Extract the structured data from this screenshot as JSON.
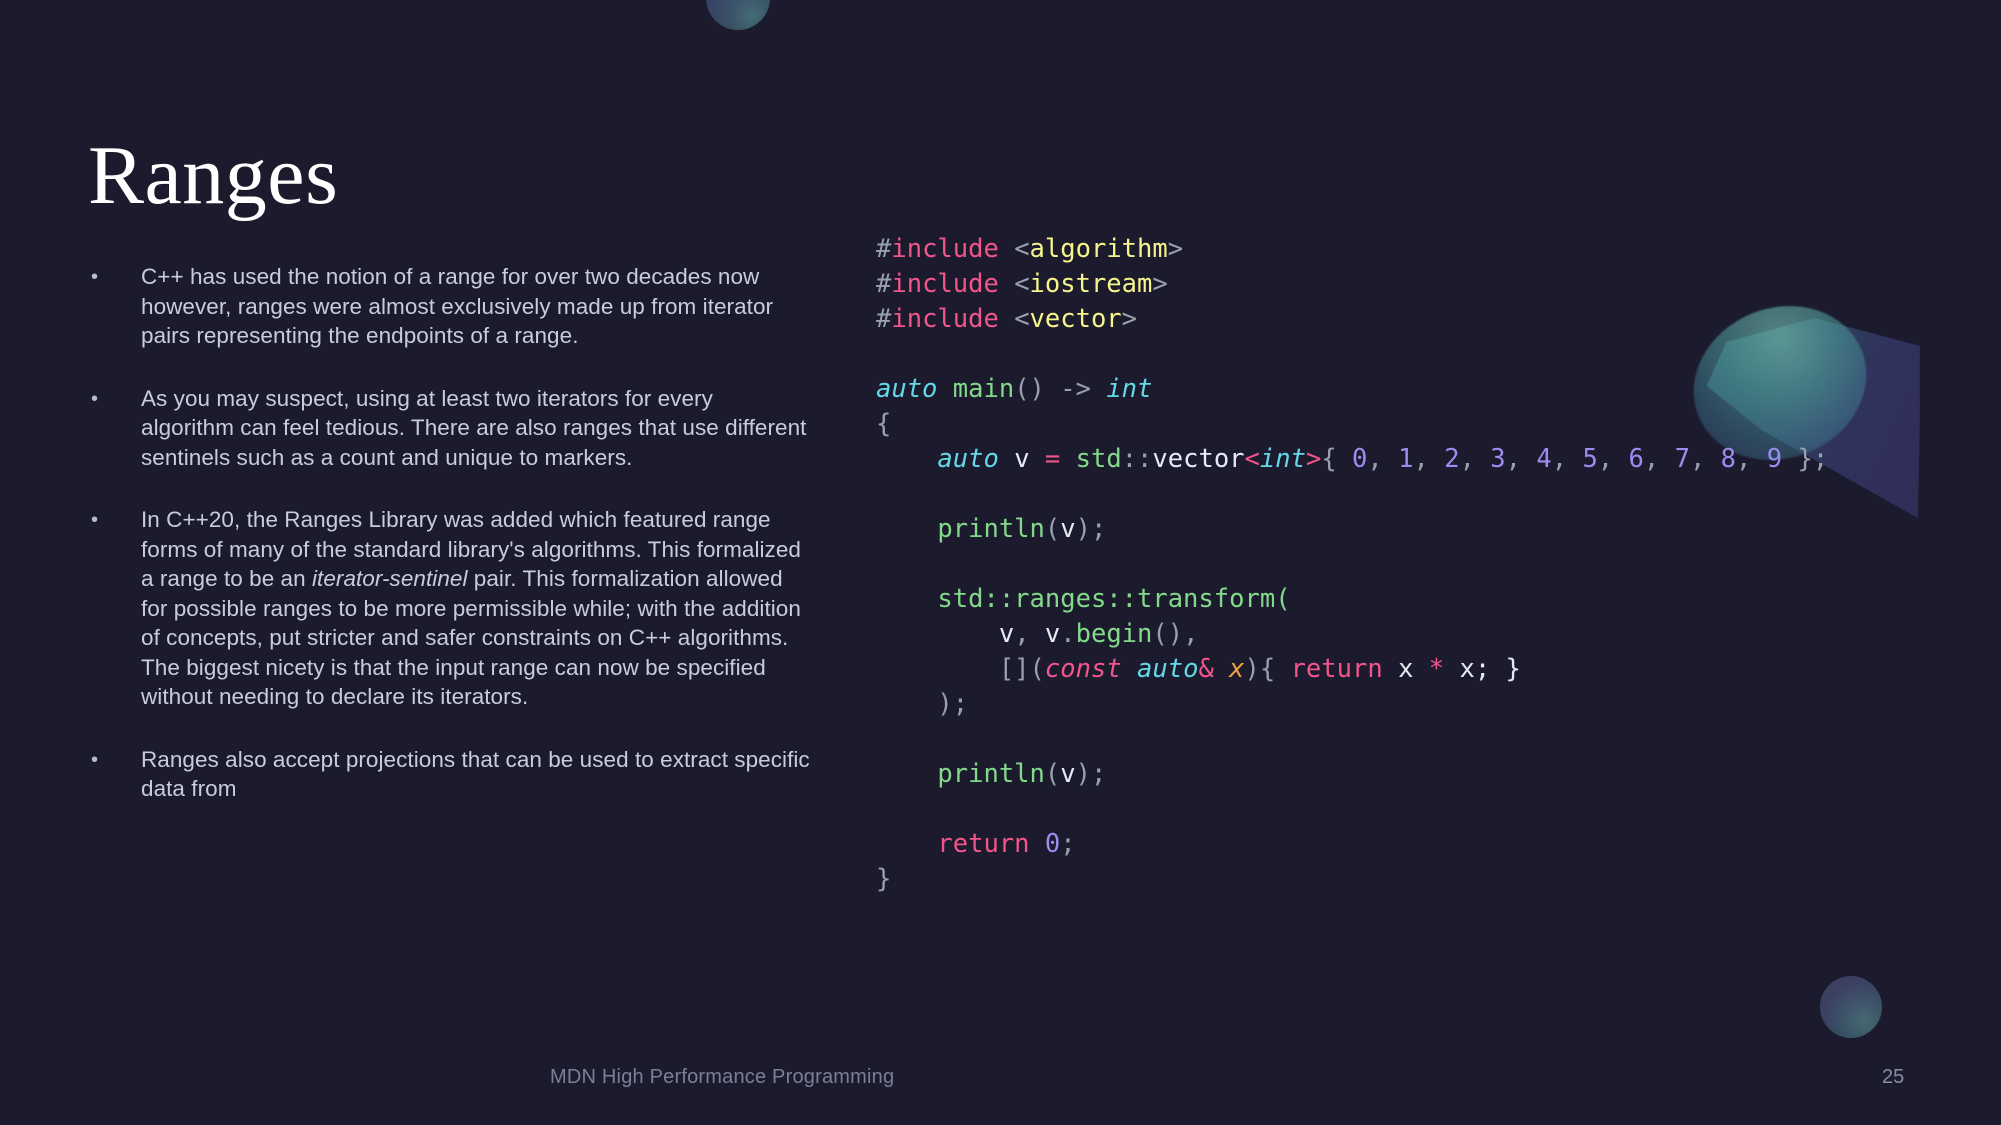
{
  "slide": {
    "background_color": "#1c1b2e",
    "title": "Ranges",
    "footer_title": "MDN High Performance Programming",
    "page_number": "25"
  },
  "bullet_marker": "•",
  "bullets": [
    {
      "id": "bullet-cpp-range-notion",
      "parts": [
        {
          "text": "C++ has used the notion of a range for over two decades now however, ranges were almost exclusively made up from iterator pairs representing the endpoints of a range.",
          "style": "normal"
        }
      ]
    },
    {
      "id": "bullet-iterator-tedious",
      "parts": [
        {
          "text": "As you may suspect, using at least two iterators for every algorithm can feel tedious. There are also ranges that use different sentinels such as a count and unique to markers.",
          "style": "normal"
        }
      ]
    },
    {
      "id": "bullet-cpp20-ranges-library",
      "parts": [
        {
          "text": "In C++20, the Ranges Library was added which featured range forms of many of the standard library's algorithms. This formalized a range to be an ",
          "style": "normal"
        },
        {
          "text": "iterator-sentinel",
          "style": "italic"
        },
        {
          "text": " pair. This formalization allowed for possible ranges to be more permissible while; with the addition of concepts, put stricter and safer constraints on C++ algorithms. The biggest nicety is that the input range can now be specified without needing to declare its iterators.",
          "style": "normal"
        }
      ]
    },
    {
      "id": "bullet-projections",
      "parts": [
        {
          "text": "Ranges also accept projections that can be used to extract specific data from",
          "style": "normal"
        }
      ]
    }
  ],
  "code": {
    "language": "cpp",
    "plain_text": "#include <algorithm>\n#include <iostream>\n#include <vector>\n\nauto main() -> int\n{\n    auto v = std::vector<int>{ 0, 1, 2, 3, 4, 5, 6, 7, 8, 9 };\n\n    println(v);\n\n    std::ranges::transform(\n        v, v.begin(),\n        [](const auto& x){ return x * x; }\n    );\n\n    println(v);\n\n    return 0;\n}",
    "lines": [
      {
        "tokens": [
          {
            "t": "#",
            "c": "punct"
          },
          {
            "t": "include",
            "c": "pp"
          },
          {
            "t": " ",
            "c": "plain"
          },
          {
            "t": "<",
            "c": "punct"
          },
          {
            "t": "algorithm",
            "c": "hdr"
          },
          {
            "t": ">",
            "c": "punct"
          }
        ]
      },
      {
        "tokens": [
          {
            "t": "#",
            "c": "punct"
          },
          {
            "t": "include",
            "c": "pp"
          },
          {
            "t": " ",
            "c": "plain"
          },
          {
            "t": "<",
            "c": "punct"
          },
          {
            "t": "iostream",
            "c": "hdr"
          },
          {
            "t": ">",
            "c": "punct"
          }
        ]
      },
      {
        "tokens": [
          {
            "t": "#",
            "c": "punct"
          },
          {
            "t": "include",
            "c": "pp"
          },
          {
            "t": " ",
            "c": "plain"
          },
          {
            "t": "<",
            "c": "punct"
          },
          {
            "t": "vector",
            "c": "hdr"
          },
          {
            "t": ">",
            "c": "punct"
          }
        ]
      },
      {
        "tokens": []
      },
      {
        "tokens": [
          {
            "t": "auto",
            "c": "type"
          },
          {
            "t": " ",
            "c": "plain"
          },
          {
            "t": "main",
            "c": "fn"
          },
          {
            "t": "() -> ",
            "c": "punct"
          },
          {
            "t": "int",
            "c": "type"
          }
        ]
      },
      {
        "tokens": [
          {
            "t": "{",
            "c": "punct"
          }
        ]
      },
      {
        "tokens": [
          {
            "t": "    ",
            "c": "plain"
          },
          {
            "t": "auto",
            "c": "type"
          },
          {
            "t": " ",
            "c": "plain"
          },
          {
            "t": "v",
            "c": "var"
          },
          {
            "t": " ",
            "c": "plain"
          },
          {
            "t": "=",
            "c": "op"
          },
          {
            "t": " ",
            "c": "plain"
          },
          {
            "t": "std",
            "c": "ns"
          },
          {
            "t": "::",
            "c": "punct"
          },
          {
            "t": "vector",
            "c": "var"
          },
          {
            "t": "<",
            "c": "op"
          },
          {
            "t": "int",
            "c": "type"
          },
          {
            "t": ">",
            "c": "op"
          },
          {
            "t": "{ ",
            "c": "punct"
          },
          {
            "t": "0",
            "c": "num"
          },
          {
            "t": ", ",
            "c": "punct"
          },
          {
            "t": "1",
            "c": "num"
          },
          {
            "t": ", ",
            "c": "punct"
          },
          {
            "t": "2",
            "c": "num"
          },
          {
            "t": ", ",
            "c": "punct"
          },
          {
            "t": "3",
            "c": "num"
          },
          {
            "t": ", ",
            "c": "punct"
          },
          {
            "t": "4",
            "c": "num"
          },
          {
            "t": ", ",
            "c": "punct"
          },
          {
            "t": "5",
            "c": "num"
          },
          {
            "t": ", ",
            "c": "punct"
          },
          {
            "t": "6",
            "c": "num"
          },
          {
            "t": ", ",
            "c": "punct"
          },
          {
            "t": "7",
            "c": "num"
          },
          {
            "t": ", ",
            "c": "punct"
          },
          {
            "t": "8",
            "c": "num"
          },
          {
            "t": ", ",
            "c": "punct"
          },
          {
            "t": "9",
            "c": "num"
          },
          {
            "t": " };",
            "c": "punct"
          }
        ]
      },
      {
        "tokens": []
      },
      {
        "tokens": [
          {
            "t": "    ",
            "c": "plain"
          },
          {
            "t": "println",
            "c": "fn"
          },
          {
            "t": "(",
            "c": "punct"
          },
          {
            "t": "v",
            "c": "var"
          },
          {
            "t": ");",
            "c": "punct"
          }
        ]
      },
      {
        "tokens": []
      },
      {
        "tokens": [
          {
            "t": "    ",
            "c": "plain"
          },
          {
            "t": "std::ranges::transform",
            "c": "fn"
          },
          {
            "t": "(",
            "c": "fn"
          }
        ]
      },
      {
        "tokens": [
          {
            "t": "        ",
            "c": "plain"
          },
          {
            "t": "v",
            "c": "var"
          },
          {
            "t": ", ",
            "c": "punct"
          },
          {
            "t": "v",
            "c": "var"
          },
          {
            "t": ".",
            "c": "punct"
          },
          {
            "t": "begin",
            "c": "fn"
          },
          {
            "t": "(),",
            "c": "punct"
          }
        ]
      },
      {
        "tokens": [
          {
            "t": "        ",
            "c": "plain"
          },
          {
            "t": "[](",
            "c": "punct"
          },
          {
            "t": "const",
            "c": "kw-i"
          },
          {
            "t": " ",
            "c": "plain"
          },
          {
            "t": "auto",
            "c": "type"
          },
          {
            "t": "&",
            "c": "op"
          },
          {
            "t": " ",
            "c": "plain"
          },
          {
            "t": "x",
            "c": "param"
          },
          {
            "t": "){ ",
            "c": "punct"
          },
          {
            "t": "return",
            "c": "kw"
          },
          {
            "t": " ",
            "c": "plain"
          },
          {
            "t": "x",
            "c": "var"
          },
          {
            "t": " ",
            "c": "plain"
          },
          {
            "t": "*",
            "c": "op"
          },
          {
            "t": " ",
            "c": "plain"
          },
          {
            "t": "x; }",
            "c": "var"
          }
        ]
      },
      {
        "tokens": [
          {
            "t": "    );",
            "c": "punct"
          }
        ]
      },
      {
        "tokens": []
      },
      {
        "tokens": [
          {
            "t": "    ",
            "c": "plain"
          },
          {
            "t": "println",
            "c": "fn"
          },
          {
            "t": "(",
            "c": "punct"
          },
          {
            "t": "v",
            "c": "var"
          },
          {
            "t": ");",
            "c": "punct"
          }
        ]
      },
      {
        "tokens": []
      },
      {
        "tokens": [
          {
            "t": "    ",
            "c": "plain"
          },
          {
            "t": "return",
            "c": "kw"
          },
          {
            "t": " ",
            "c": "plain"
          },
          {
            "t": "0",
            "c": "num"
          },
          {
            "t": ";",
            "c": "punct"
          }
        ]
      },
      {
        "tokens": [
          {
            "t": "}",
            "c": "punct"
          }
        ]
      }
    ],
    "palette": {
      "punct": "#9aa0ae",
      "preprocessor": "#f1558a",
      "header_name": "#f7f48b",
      "keyword": "#f1558a",
      "type": "#63d9e8",
      "function": "#83d98a",
      "variable": "#e8eaf2",
      "parameter": "#f5a03c",
      "number": "#9b8cf0",
      "operator": "#f1558a"
    }
  },
  "decorations": [
    {
      "name": "sphere-top",
      "shape": "sphere"
    },
    {
      "name": "cone-right",
      "shape": "cone"
    },
    {
      "name": "sphere-bottom-right",
      "shape": "sphere"
    }
  ]
}
